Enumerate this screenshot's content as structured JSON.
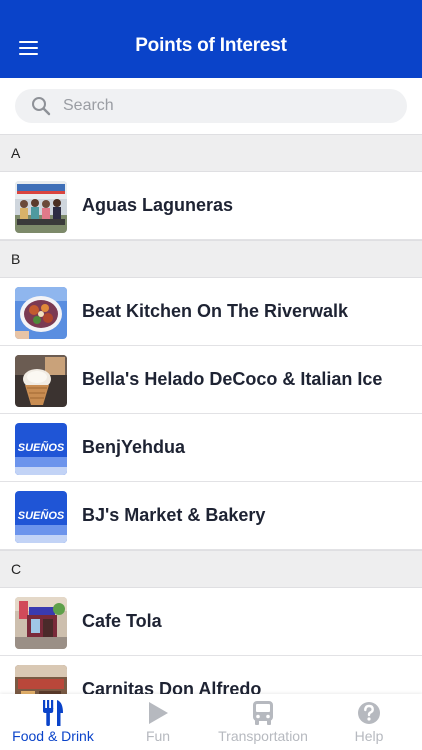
{
  "header": {
    "title": "Points of Interest",
    "menu_icon": "hamburger-menu-icon"
  },
  "search": {
    "placeholder": "Search",
    "value": "",
    "icon": "search-icon"
  },
  "sections": [
    {
      "letter": "A",
      "items": [
        {
          "label": "Aguas Laguneras",
          "thumb": "people-photo"
        }
      ]
    },
    {
      "letter": "B",
      "items": [
        {
          "label": "Beat Kitchen On The Riverwalk",
          "thumb": "food-plate-photo"
        },
        {
          "label": "Bella's Helado DeCoco & Italian Ice",
          "thumb": "ice-cream-photo"
        },
        {
          "label": "BenjYehdua",
          "thumb": "suenos-logo",
          "thumb_text": "SUEÑOS"
        },
        {
          "label": "BJ's Market & Bakery",
          "thumb": "suenos-logo",
          "thumb_text": "SUEÑOS"
        }
      ]
    },
    {
      "letter": "C",
      "items": [
        {
          "label": "Cafe Tola",
          "thumb": "storefront-photo"
        },
        {
          "label": "Carnitas Don Alfredo",
          "thumb": "market-photo"
        }
      ]
    }
  ],
  "tabs": [
    {
      "label": "Food & Drink",
      "icon": "fork-knife-icon",
      "active": true
    },
    {
      "label": "Fun",
      "icon": "play-icon",
      "active": false
    },
    {
      "label": "Transportation",
      "icon": "bus-icon",
      "active": false
    },
    {
      "label": "Help",
      "icon": "question-circle-icon",
      "active": false
    }
  ],
  "colors": {
    "primary": "#0a43c9",
    "inactive_tab": "#b6b9bf",
    "section_bg": "#eeeeef"
  }
}
